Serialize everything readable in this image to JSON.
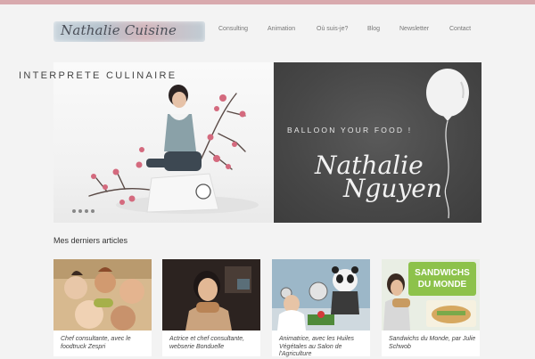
{
  "header": {
    "logo_text": "Nathalie Cuisine",
    "nav": [
      "Consulting",
      "Animation",
      "Où suis-je?",
      "Blog",
      "Newsletter",
      "Contact"
    ]
  },
  "banner_left": {
    "title": "INTERPRETE CULINAIRE",
    "slide_count": 4
  },
  "banner_right": {
    "tagline": "BALLOON YOUR FOOD !",
    "name_line1": "Nathalie",
    "name_line2": "Nguyen"
  },
  "articles": {
    "title": "Mes derniers articles",
    "items": [
      {
        "caption": "Chef consultante, avec le foodtruck Zespri"
      },
      {
        "caption": "Actrice et chef consultante, webserie Bonduelle"
      },
      {
        "caption": "Animatrice, avec les Huiles Végétales au Salon de l'Agriculture"
      },
      {
        "caption": "Sandwichs du Monde, par Julie Schwob"
      }
    ],
    "card4_image_text": [
      "SANDWICHS",
      "DU MONDE"
    ]
  },
  "colors": {
    "top_bar": "#d8a9ad",
    "background": "#f3f3f3",
    "dark_banner": "#474747"
  }
}
